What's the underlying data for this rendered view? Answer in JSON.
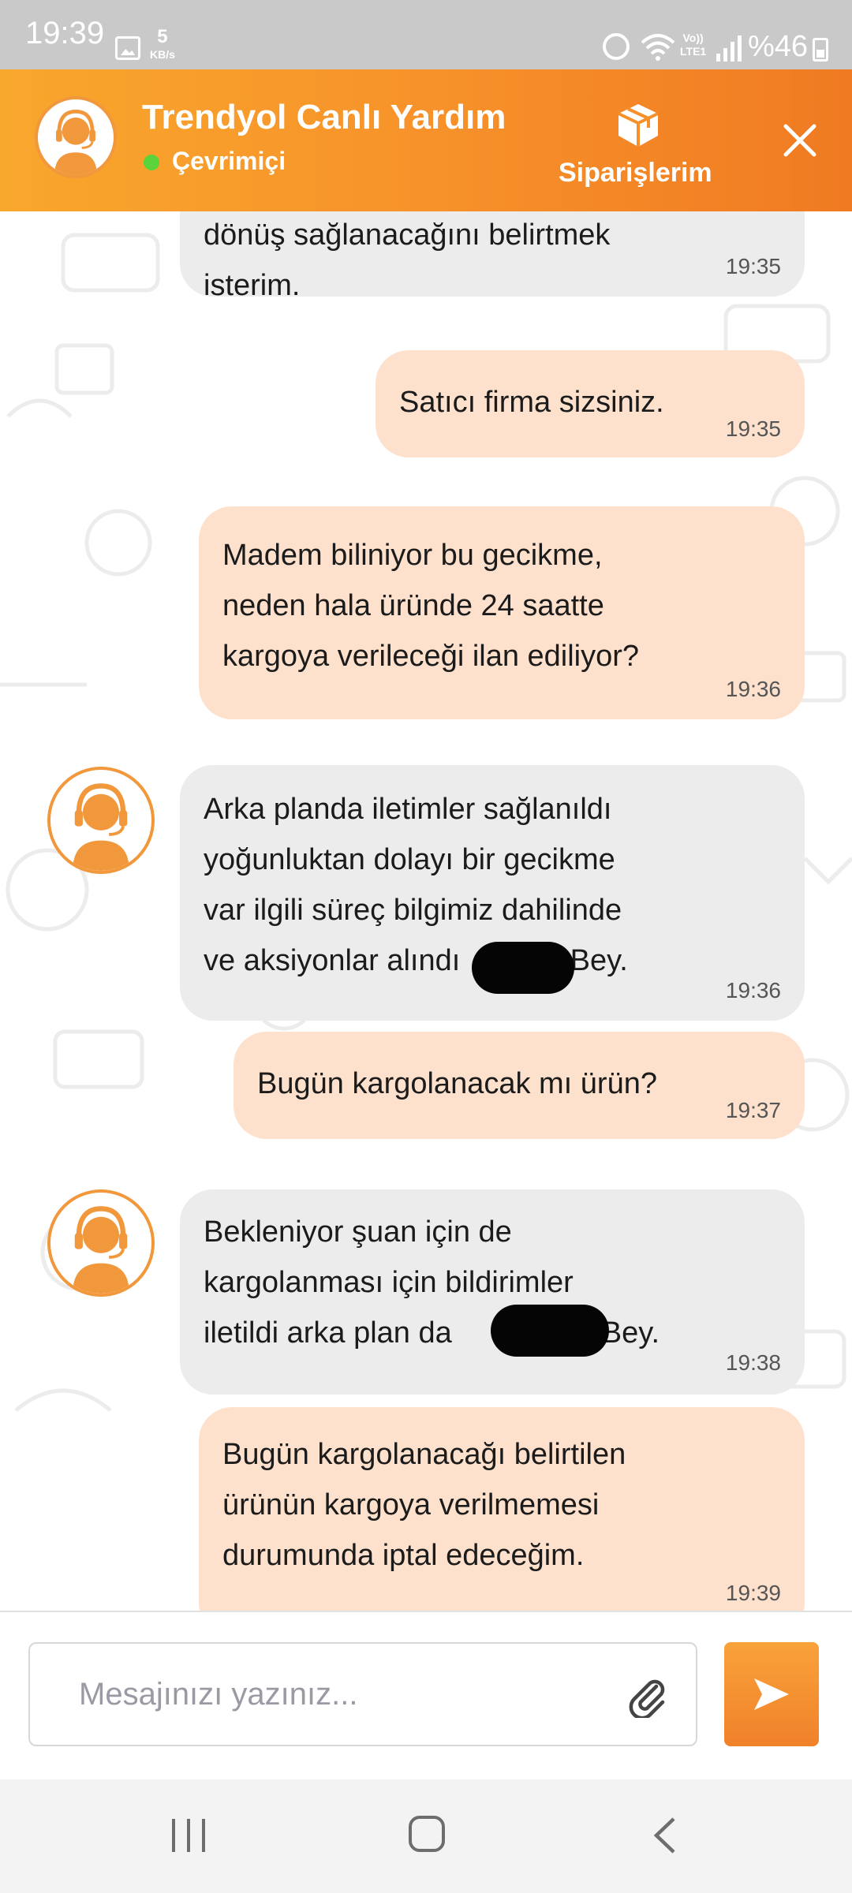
{
  "status_bar": {
    "time": "19:39",
    "net_speed_value": "5",
    "net_speed_unit": "KB/s",
    "lte_label_top": "Vo))",
    "lte_label_bottom": "LTE1",
    "battery": "%46"
  },
  "header": {
    "title": "Trendyol Canlı Yardım",
    "status": "Çevrimiçi",
    "orders_label": "Siparişlerim"
  },
  "messages": [
    {
      "from": "agent",
      "text": "dönüş sağlanacağını belirtmek\nisterim.",
      "time": "19:35"
    },
    {
      "from": "user",
      "text": "Satıcı firma sizsiniz.",
      "time": "19:35"
    },
    {
      "from": "user",
      "text": "Madem biliniyor bu gecikme,\nneden hala üründe 24 saatte\nkargoya verileceği ilan ediliyor?",
      "time": "19:36"
    },
    {
      "from": "agent",
      "text": "Arka planda iletimler sağlanıldı\nyoğunluktan dolayı bir gecikme\nvar ilgili süreç bilgimiz dahilinde\nve aksiyonlar alındı           r Bey.",
      "time": "19:36"
    },
    {
      "from": "user",
      "text": "Bugün kargolanacak mı ürün?",
      "time": "19:37"
    },
    {
      "from": "agent",
      "text": "Bekleniyor şuan için de\nkargolanması için bildirimler\niletildi arka plan da                  Bey.",
      "time": "19:38"
    },
    {
      "from": "user",
      "text": "Bugün kargolanacağı belirtilen\nürünün kargoya verilmemesi\ndurumunda iptal edeceğim.",
      "time": "19:39"
    }
  ],
  "input": {
    "placeholder": "Mesajınızı yazınız..."
  },
  "colors": {
    "header_gradient_start": "#f8a72d",
    "header_gradient_end": "#f07a22",
    "incoming_bubble": "#ececec",
    "outgoing_bubble": "#fde1cc",
    "online_dot": "#5ad43a"
  },
  "icons": {
    "orders": "package-icon",
    "close": "close-icon",
    "attach": "paperclip-icon",
    "send": "send-icon",
    "agent_avatar": "headset-agent-icon"
  }
}
